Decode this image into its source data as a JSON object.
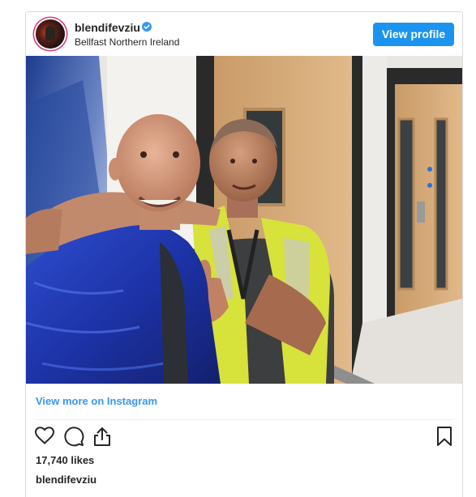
{
  "post": {
    "username": "blendifevziu",
    "location": "Bellfast Northern Ireland",
    "view_profile_label": "View profile",
    "view_more_label": "View more on Instagram",
    "likes": "17,740 likes",
    "caption_username": "blendifevziu"
  },
  "icons": {
    "verified": "verified-badge-icon",
    "like": "heart-icon",
    "comment": "comment-bubble-icon",
    "share": "share-icon",
    "save": "bookmark-icon"
  },
  "colors": {
    "accent": "#1a94ef",
    "link": "#3897f0",
    "text": "#262626",
    "border": "#dbdbdb"
  }
}
